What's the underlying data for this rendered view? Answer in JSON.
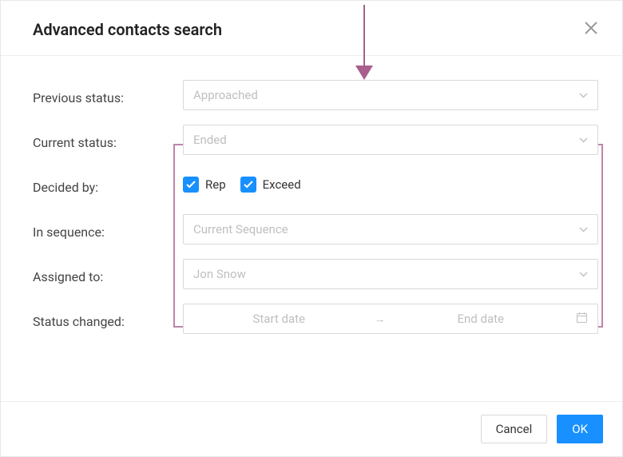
{
  "header": {
    "title": "Advanced contacts search"
  },
  "fields": {
    "previous_status": {
      "label": "Previous status:",
      "value": "Approached"
    },
    "current_status": {
      "label": "Current status:",
      "value": "Ended"
    },
    "decided_by": {
      "label": "Decided by:",
      "options": [
        {
          "label": "Rep",
          "checked": true
        },
        {
          "label": "Exceed",
          "checked": true
        }
      ]
    },
    "in_sequence": {
      "label": "In sequence:",
      "value": "Current Sequence"
    },
    "assigned_to": {
      "label": "Assigned to:",
      "value": "Jon Snow"
    },
    "status_changed": {
      "label": "Status changed:",
      "start_placeholder": "Start date",
      "end_placeholder": "End date"
    }
  },
  "footer": {
    "cancel": "Cancel",
    "ok": "OK"
  },
  "colors": {
    "accent": "#1890ff",
    "highlight_border": "#be85ab",
    "arrow": "#a85f8d"
  }
}
